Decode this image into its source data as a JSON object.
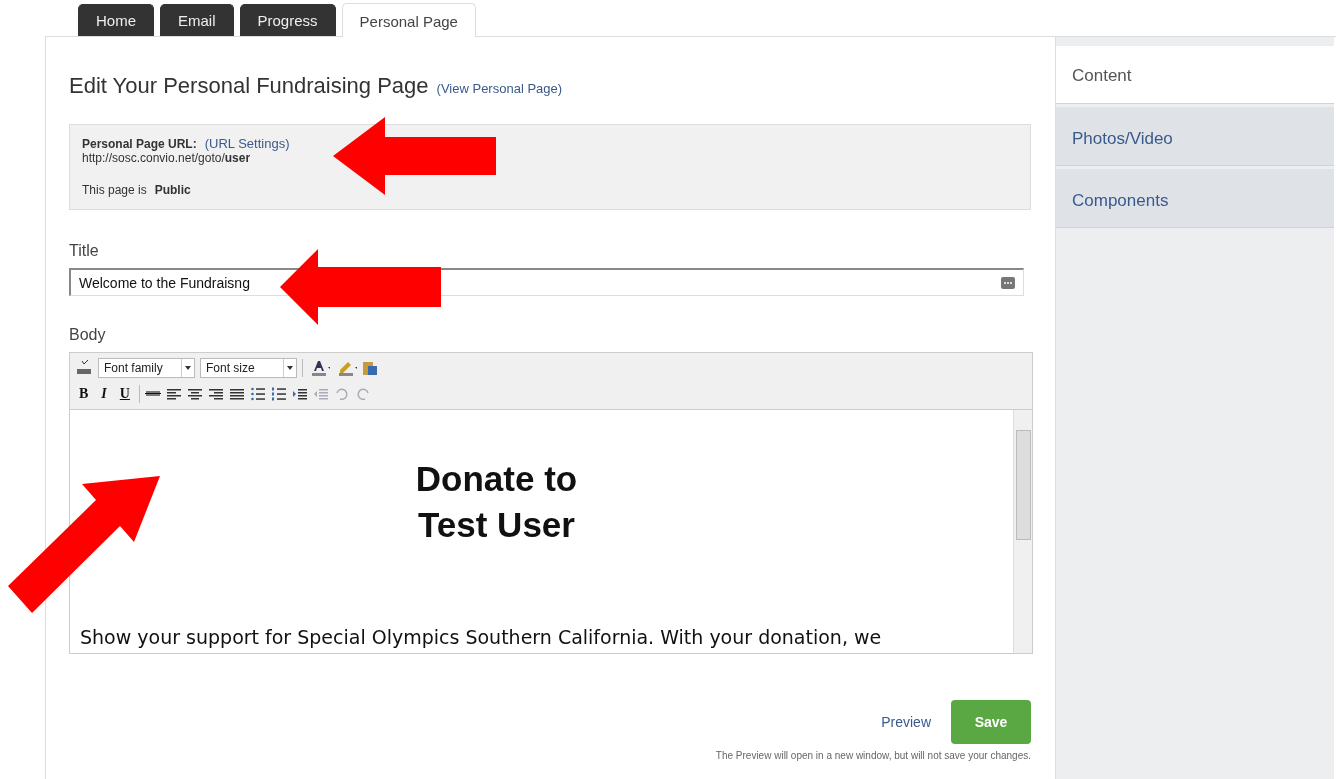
{
  "tabs": [
    {
      "label": "Home",
      "selected": false
    },
    {
      "label": "Email",
      "selected": false
    },
    {
      "label": "Progress",
      "selected": false
    },
    {
      "label": "Personal Page",
      "selected": true
    }
  ],
  "heading": {
    "title": "Edit Your Personal Fundraising Page",
    "link": "(View Personal Page)"
  },
  "url_box": {
    "label": "Personal Page URL:",
    "link": "(URL Settings)",
    "url": "http://sosc.convio.net/goto/**user**",
    "status_prefix": "This page is",
    "status": "Public"
  },
  "title_field": {
    "label": "Title",
    "value": "Welcome to the Fundraisng"
  },
  "body_field": {
    "label": "Body",
    "toolbar_row_1": [
      {
        "kind": "spell"
      },
      {
        "kind": "select",
        "value": "Font family"
      },
      {
        "kind": "select",
        "value": "Font size"
      },
      {
        "kind": "sep"
      },
      {
        "kind": "textcolor"
      },
      {
        "kind": "highlight"
      },
      {
        "kind": "paste"
      }
    ],
    "toolbar_row_2": [
      {
        "kind": "bold",
        "label": "B"
      },
      {
        "kind": "italic",
        "label": "I"
      },
      {
        "kind": "underline",
        "label": "U"
      },
      {
        "kind": "sep"
      },
      {
        "kind": "strike"
      },
      {
        "kind": "align-left"
      },
      {
        "kind": "align-center"
      },
      {
        "kind": "align-right"
      },
      {
        "kind": "justify"
      },
      {
        "kind": "bullets"
      },
      {
        "kind": "numbers"
      },
      {
        "kind": "indent"
      },
      {
        "kind": "outdent",
        "disabled": true
      },
      {
        "kind": "undo",
        "disabled": true
      },
      {
        "kind": "redo",
        "disabled": true
      }
    ],
    "headline": [
      "Donate to",
      "Test User"
    ],
    "paragraph": "Show your support for Special Olympics Southern California. With your donation, we"
  },
  "actions": {
    "preview": "Preview",
    "save": "Save",
    "note": "The Preview will open in a new window, but will not save your changes."
  },
  "sidebar": [
    {
      "label": "Content",
      "selected": true
    },
    {
      "label": "Photos/Video",
      "selected": false
    },
    {
      "label": "Components",
      "selected": false
    }
  ]
}
